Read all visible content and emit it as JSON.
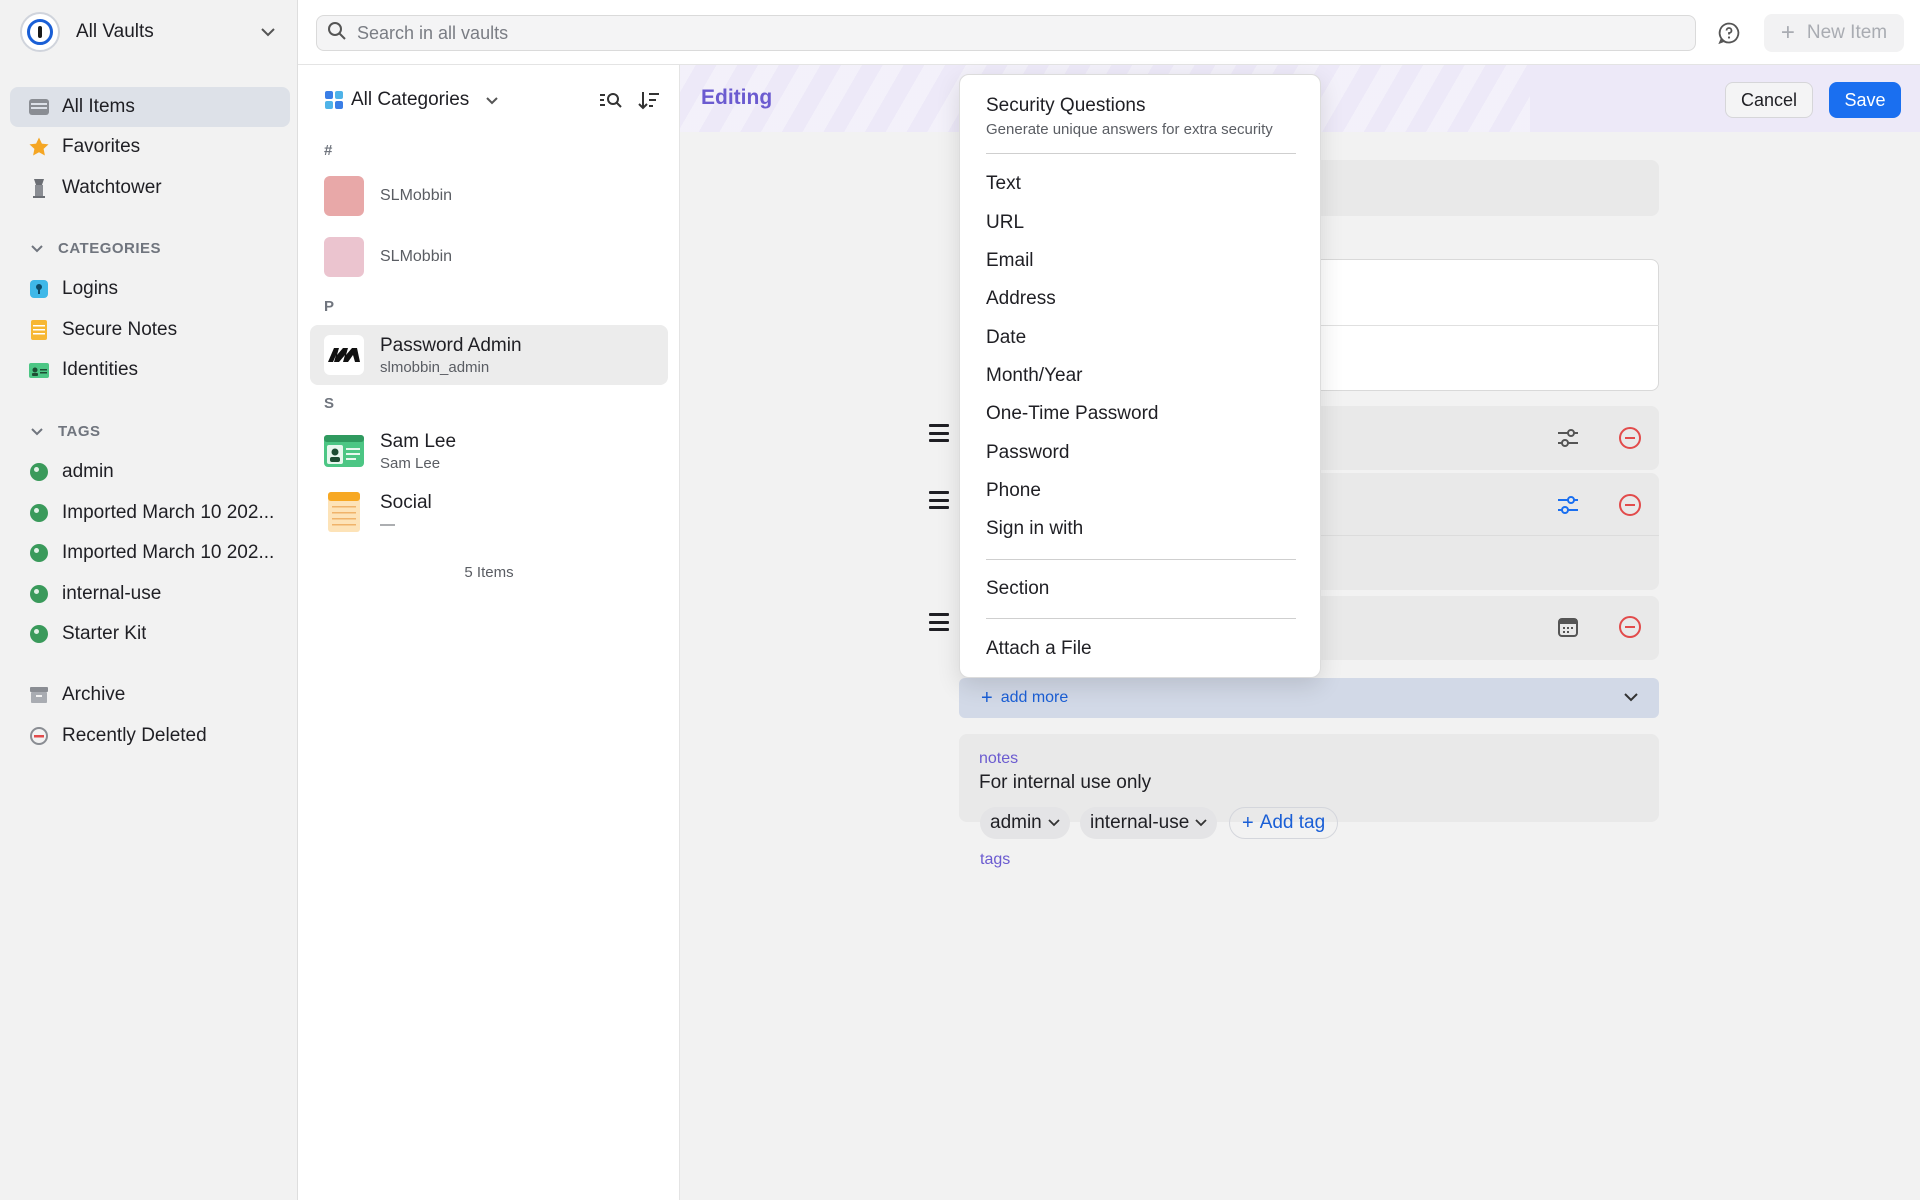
{
  "sidebar": {
    "vault_name": "All Vaults",
    "nav": [
      {
        "label": "All Items"
      },
      {
        "label": "Favorites"
      },
      {
        "label": "Watchtower"
      }
    ],
    "categories_heading": "CATEGORIES",
    "categories": [
      {
        "label": "Logins"
      },
      {
        "label": "Secure Notes"
      },
      {
        "label": "Identities"
      }
    ],
    "tags_heading": "TAGS",
    "tags": [
      {
        "label": "admin"
      },
      {
        "label": "Imported March 10 202..."
      },
      {
        "label": "Imported March 10 202..."
      },
      {
        "label": "internal-use"
      },
      {
        "label": "Starter Kit"
      }
    ],
    "archive_label": "Archive",
    "recently_deleted_label": "Recently Deleted"
  },
  "topbar": {
    "search_placeholder": "Search in all vaults",
    "new_item_label": "New Item"
  },
  "list": {
    "category_filter": "All Categories",
    "groups": [
      {
        "letter": "#"
      },
      {
        "letter": "P"
      },
      {
        "letter": "S"
      }
    ],
    "items": [
      {
        "title": "SLMobbin",
        "subtitle": ""
      },
      {
        "title": "SLMobbin",
        "subtitle": ""
      },
      {
        "title": "Password Admin",
        "subtitle": "slmobbin_admin"
      },
      {
        "title": "Sam Lee",
        "subtitle": "Sam Lee"
      },
      {
        "title": "Social",
        "subtitle": "—"
      }
    ],
    "count_label": "5 Items"
  },
  "detail": {
    "editing_label": "Editing",
    "cancel_label": "Cancel",
    "save_label": "Save",
    "add_more_label": "add more",
    "notes_label": "notes",
    "notes_value": "For internal use only",
    "tags_label": "tags",
    "tags": [
      "admin",
      "internal-use"
    ],
    "add_tag_label": "Add tag"
  },
  "menu": {
    "header_title": "Security Questions",
    "header_subtitle": "Generate unique answers for extra security",
    "field_types": [
      "Text",
      "URL",
      "Email",
      "Address",
      "Date",
      "Month/Year",
      "One-Time Password",
      "Password",
      "Phone",
      "Sign in with"
    ],
    "section_label": "Section",
    "attach_label": "Attach a File"
  },
  "colors": {
    "accent_blue": "#1a6ff0",
    "editing_purple": "#6b5bd0",
    "danger_red": "#e24b4b",
    "tag_green": "#3a9a5b"
  }
}
